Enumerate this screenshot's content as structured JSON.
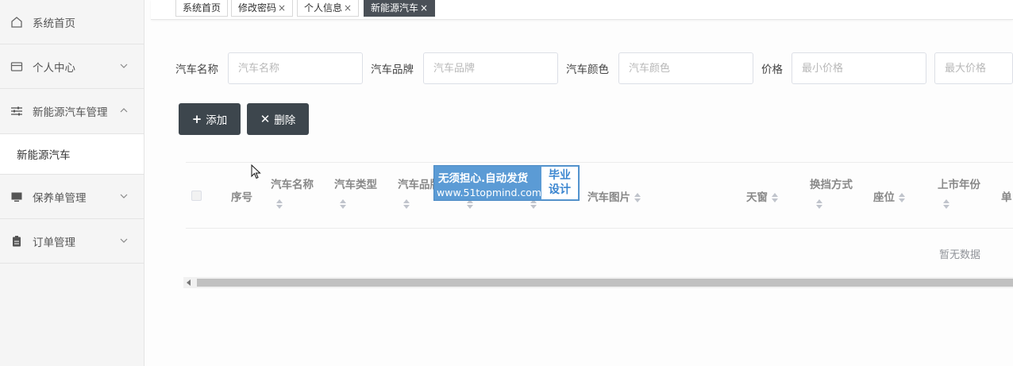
{
  "sidebar": {
    "items": [
      {
        "label": "系统首页",
        "icon": "home-icon"
      },
      {
        "label": "个人中心",
        "icon": "card-icon"
      },
      {
        "label": "新能源汽车管理",
        "icon": "sliders-icon"
      },
      {
        "label": "新能源汽车"
      },
      {
        "label": "保养单管理",
        "icon": "monitor-icon"
      },
      {
        "label": "订单管理",
        "icon": "clipboard-icon"
      }
    ]
  },
  "tabs": [
    {
      "label": "系统首页"
    },
    {
      "label": "修改密码",
      "close": "×"
    },
    {
      "label": "个人信息",
      "close": "×"
    },
    {
      "label": "新能源汽车",
      "close": "×"
    }
  ],
  "search": {
    "name_label": "汽车名称",
    "name_placeholder": "汽车名称",
    "brand_label": "汽车品牌",
    "brand_placeholder": "汽车品牌",
    "color_label": "汽车颜色",
    "color_placeholder": "汽车颜色",
    "price_label": "价格",
    "min_price_placeholder": "最小价格",
    "max_price_placeholder": "最大价格"
  },
  "toolbar": {
    "add_label": "添加",
    "add_icon": "+",
    "delete_label": "删除",
    "delete_icon": "✕"
  },
  "table": {
    "columns": [
      "序号",
      "汽车名称",
      "汽车类型",
      "汽车品牌",
      "汽车图片",
      "天窗",
      "换挡方式",
      "座位",
      "上市年份",
      "单"
    ],
    "empty_text": "暂无数据"
  },
  "watermark": {
    "line1": "无须担心.自动发货",
    "line2": "www.51topmind.com",
    "box_line1": "毕业",
    "box_line2": "设计"
  },
  "colors": {
    "button_bg": "#3d464d",
    "active_tab_bg": "#4a5057",
    "watermark_bg": "#5b9bd5"
  }
}
